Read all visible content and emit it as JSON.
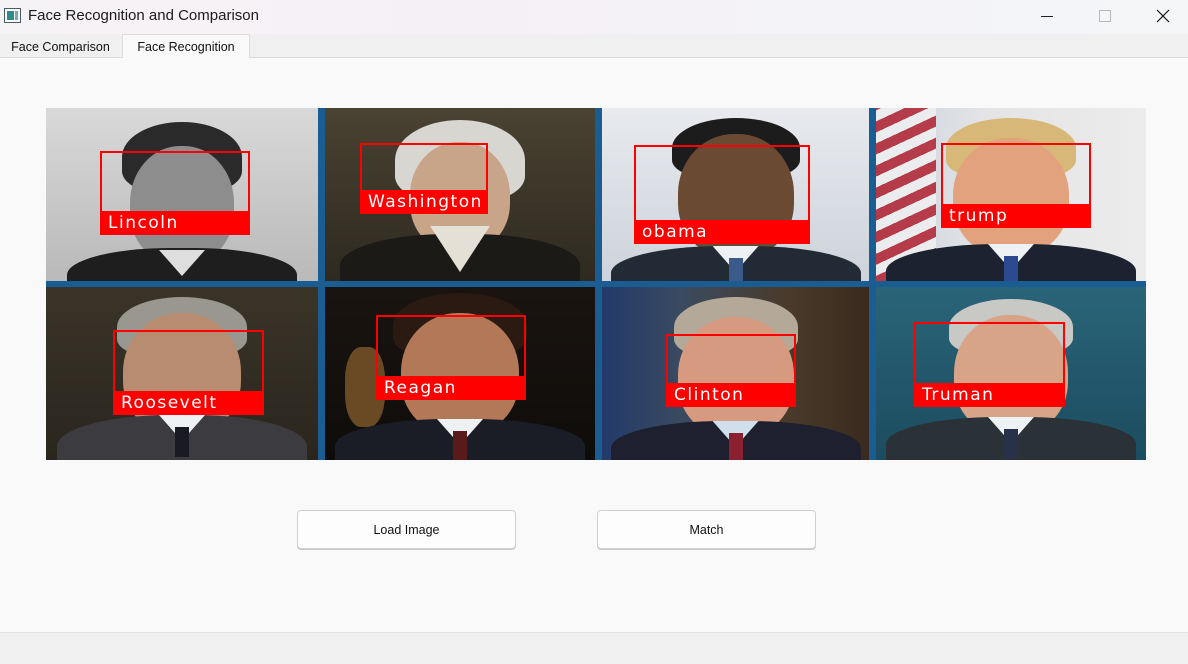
{
  "window": {
    "title": "Face Recognition and Comparison",
    "controls": [
      "minimize",
      "maximize",
      "close"
    ]
  },
  "tabs": [
    {
      "label": "Face Comparison",
      "active": false
    },
    {
      "label": "Face Recognition",
      "active": true
    }
  ],
  "image": {
    "detections": [
      {
        "name": "Lincoln"
      },
      {
        "name": "Washington"
      },
      {
        "name": "obama"
      },
      {
        "name": "trump"
      },
      {
        "name": "Roosevelt"
      },
      {
        "name": "Reagan"
      },
      {
        "name": "Clinton"
      },
      {
        "name": "Truman"
      }
    ],
    "box_color": "#ff0000",
    "label_text_color": "#ffffff",
    "grid_divider_color": "#1a5d93"
  },
  "buttons": {
    "load_image": "Load Image",
    "match": "Match"
  }
}
